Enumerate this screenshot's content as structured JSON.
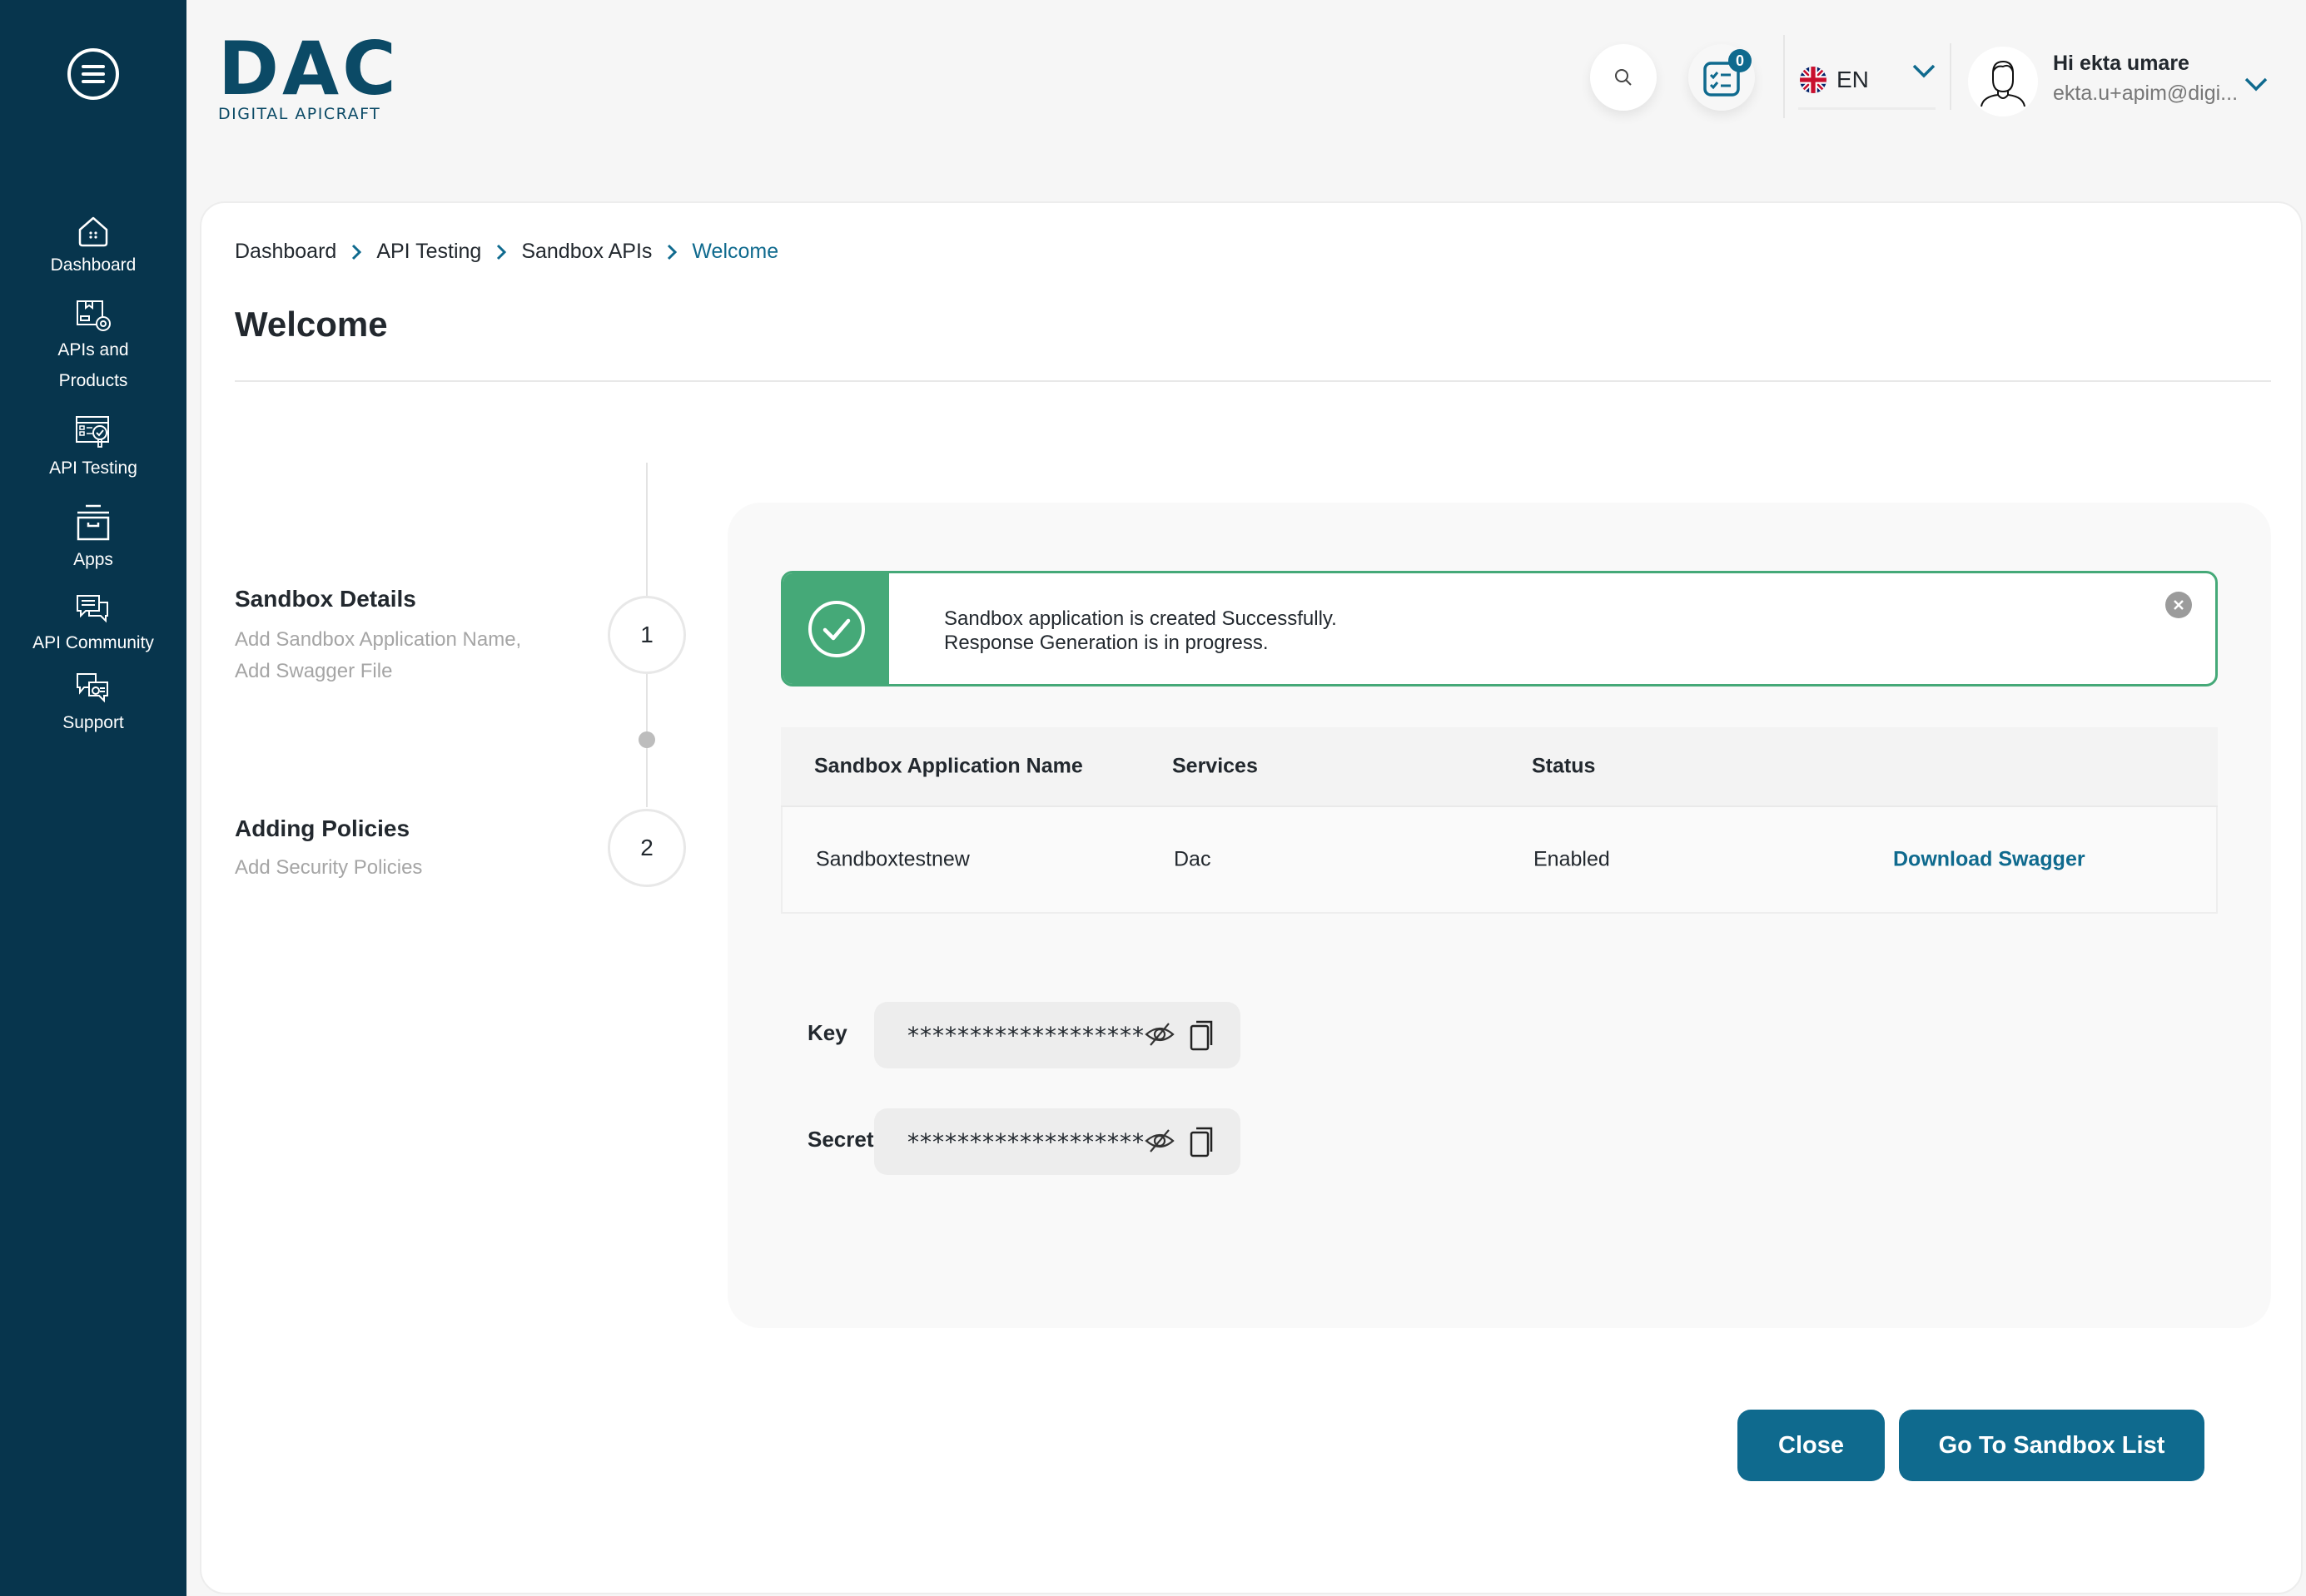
{
  "app": {
    "logo_text": "DAC",
    "logo_subtitle": "DIGITAL APICRAFT",
    "brand_color": "#0f6a8e",
    "sidebar_color": "#07354d",
    "success_color": "#45a978"
  },
  "sidebar": {
    "menu_icon": "hamburger-menu-icon",
    "items": [
      {
        "label": "Dashboard",
        "icon": "home-icon"
      },
      {
        "label": "APIs and Products",
        "icon": "api-products-icon"
      },
      {
        "label": "API Testing",
        "icon": "api-testing-icon"
      },
      {
        "label": "Apps",
        "icon": "archive-box-icon"
      },
      {
        "label": "API Community",
        "icon": "chat-bubbles-icon"
      },
      {
        "label": "Support",
        "icon": "support-chat-icon"
      }
    ]
  },
  "header": {
    "search_icon": "search-icon",
    "tasks_icon": "checklist-icon",
    "tasks_count": "0",
    "language": {
      "code": "EN",
      "flag": "uk-flag-icon"
    },
    "user": {
      "greeting": "Hi ekta umare",
      "email": "ekta.u+apim@digi..."
    }
  },
  "breadcrumb": [
    "Dashboard",
    "API Testing",
    "Sandbox APIs",
    "Welcome"
  ],
  "page": {
    "title": "Welcome"
  },
  "stepper": [
    {
      "number": "1",
      "title": "Sandbox Details",
      "desc_line1": "Add Sandbox Application Name,",
      "desc_line2": "Add Swagger File"
    },
    {
      "number": "2",
      "title": "Adding Policies",
      "desc_line1": "Add Security Policies"
    }
  ],
  "alert": {
    "line1": "Sandbox application is created Successfully.",
    "line2": "Response Generation is in progress."
  },
  "table": {
    "headers": [
      "Sandbox Application Name",
      "Services",
      "Status",
      ""
    ],
    "rows": [
      {
        "name": "Sandboxtestnew",
        "service": "Dac",
        "status": "Enabled",
        "action": "Download Swagger"
      }
    ]
  },
  "credentials": {
    "key": {
      "label": "Key",
      "value": "*******************"
    },
    "secret": {
      "label": "Secret",
      "value": "*******************"
    }
  },
  "actions": {
    "close_label": "Close",
    "go_to_list_label": "Go To Sandbox List"
  }
}
